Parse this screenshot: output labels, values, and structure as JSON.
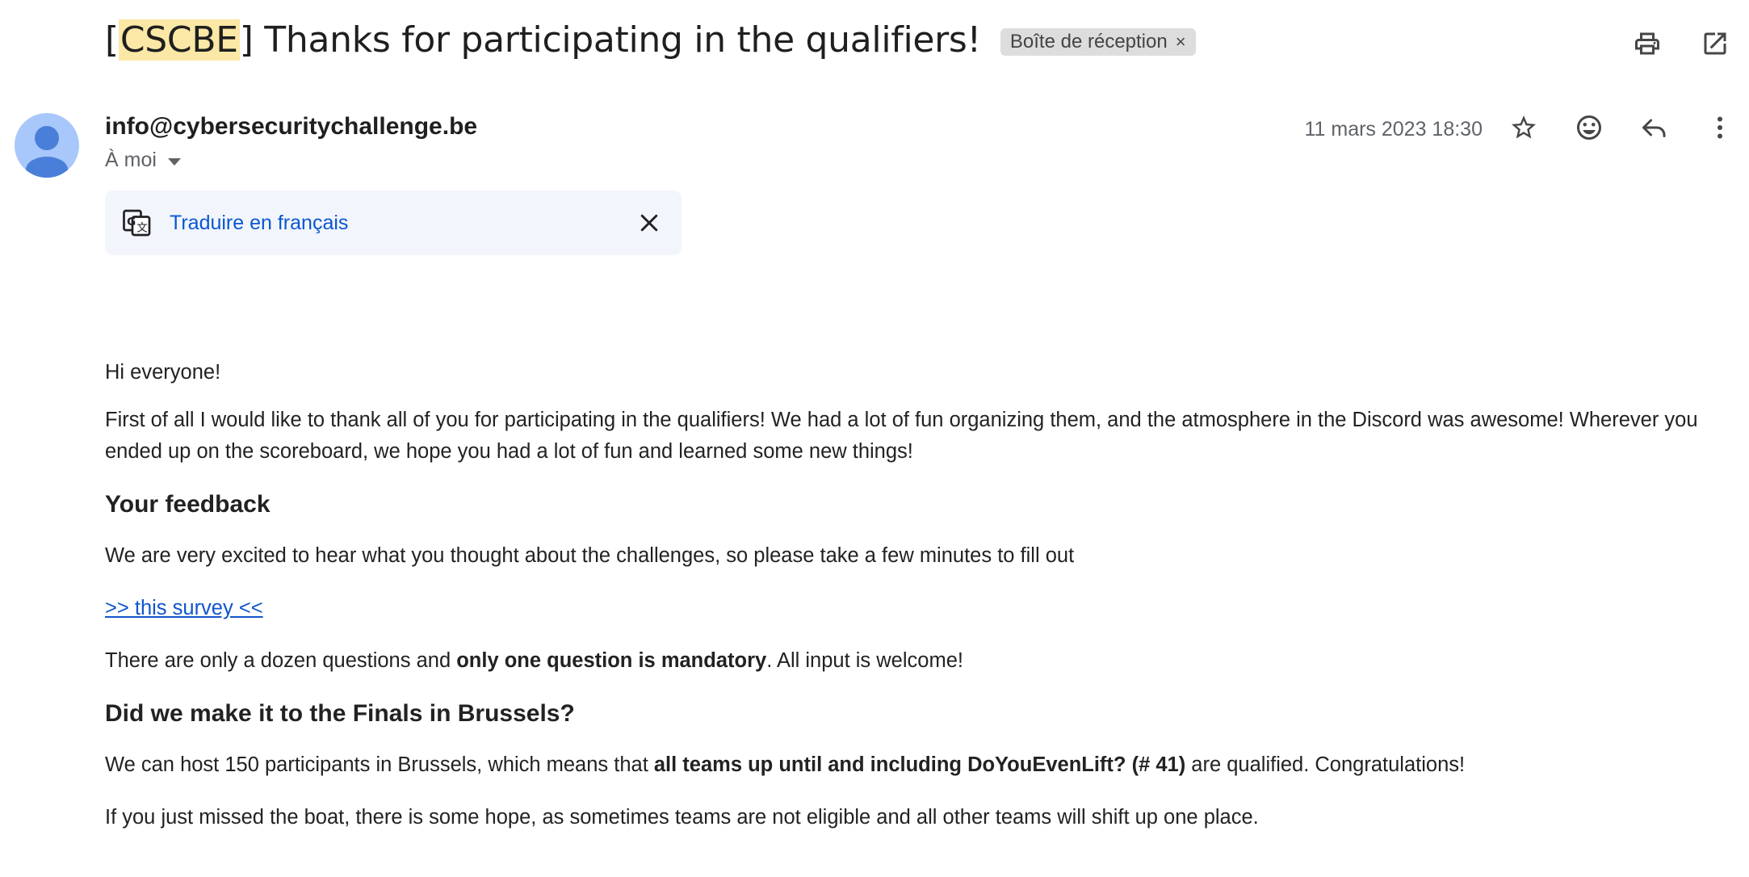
{
  "subject": {
    "prefix_open": "[",
    "tag": "CSCBE",
    "rest": "] Thanks for participating in the qualifiers!",
    "label_chip": "Boîte de réception",
    "label_close": "×"
  },
  "message": {
    "sender": "info@cybersecuritychallenge.be",
    "recipient": "À moi",
    "date": "11 mars 2023 18:30"
  },
  "translate": {
    "link": "Traduire en français"
  },
  "body": {
    "greeting": "Hi everyone!",
    "intro": "First of all I would like to thank all of you for participating in the qualifiers! We had a lot of fun organizing them, and the atmosphere in the Discord was awesome! Wherever you ended up on the scoreboard, we hope you had a lot of fun and learned some new things!",
    "h_feedback": "Your feedback",
    "feedback_p": "We are very excited to hear what you thought about the challenges, so please take a few minutes to fill out",
    "survey_link": ">> this survey <<",
    "q_pre": "There are only a dozen questions and ",
    "q_bold": "only one question is mandatory",
    "q_post": ". All input is welcome!",
    "h_finals": "Did we make it to the Finals in Brussels?",
    "host_pre": "We can host 150 participants in Brussels, which means that ",
    "host_bold": "all teams up until and including DoYouEvenLift? (# 41)",
    "host_post": " are qualified. Congratulations!",
    "missed": "If you just missed the boat, there is some hope, as sometimes teams are not eligible and all other teams will shift up one place."
  },
  "colors": {
    "highlight": "#fce8a6",
    "link": "#1155cc",
    "translate_link": "#0b57d0",
    "avatar_bg": "#a8c7fa",
    "avatar_fg": "#4a7fd9"
  },
  "icons": [
    "print-icon",
    "open-in-new-window-icon",
    "star-icon",
    "emoji-icon",
    "reply-icon",
    "more-vert-icon",
    "google-translate-icon",
    "close-icon"
  ]
}
